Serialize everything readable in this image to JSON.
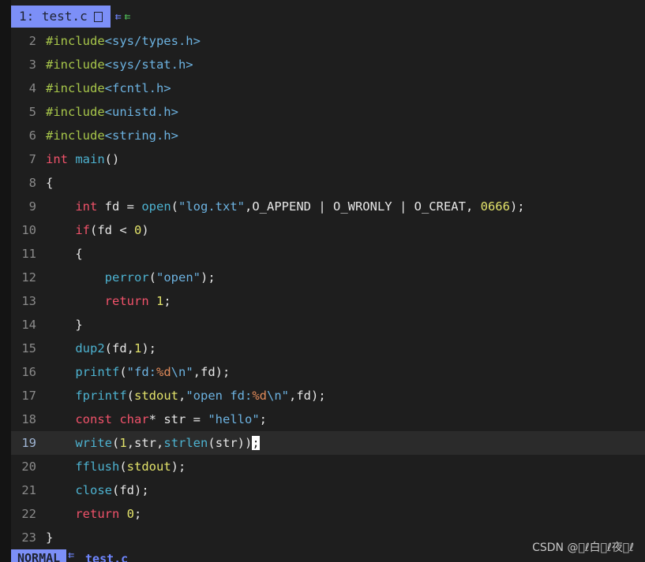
{
  "tabline": {
    "active_tab": "1: test.c",
    "arrow_left": "⇇",
    "arrow_right": "⇇"
  },
  "editor": {
    "current_line": "19",
    "lines": [
      {
        "n": "2",
        "tokens": [
          [
            "pp",
            "#include"
          ],
          [
            "inc",
            "<sys/types.h>"
          ]
        ]
      },
      {
        "n": "3",
        "tokens": [
          [
            "pp",
            "#include"
          ],
          [
            "inc",
            "<sys/stat.h>"
          ]
        ]
      },
      {
        "n": "4",
        "tokens": [
          [
            "pp",
            "#include"
          ],
          [
            "inc",
            "<fcntl.h>"
          ]
        ]
      },
      {
        "n": "5",
        "tokens": [
          [
            "pp",
            "#include"
          ],
          [
            "inc",
            "<unistd.h>"
          ]
        ]
      },
      {
        "n": "6",
        "tokens": [
          [
            "pp",
            "#include"
          ],
          [
            "inc",
            "<string.h>"
          ]
        ]
      },
      {
        "n": "7",
        "tokens": [
          [
            "kw",
            "int"
          ],
          [
            "txt",
            " "
          ],
          [
            "fn",
            "main"
          ],
          [
            "txt",
            "()"
          ]
        ]
      },
      {
        "n": "8",
        "tokens": [
          [
            "txt",
            "{"
          ]
        ]
      },
      {
        "n": "9",
        "tokens": [
          [
            "txt",
            "    "
          ],
          [
            "kw",
            "int"
          ],
          [
            "txt",
            " fd = "
          ],
          [
            "fn",
            "open"
          ],
          [
            "txt",
            "("
          ],
          [
            "str",
            "\"log.txt\""
          ],
          [
            "txt",
            ",O_APPEND | O_WRONLY | O_CREAT, "
          ],
          [
            "num",
            "0666"
          ],
          [
            "txt",
            ");"
          ]
        ]
      },
      {
        "n": "10",
        "tokens": [
          [
            "txt",
            "    "
          ],
          [
            "kw",
            "if"
          ],
          [
            "txt",
            "(fd < "
          ],
          [
            "num",
            "0"
          ],
          [
            "txt",
            ")"
          ]
        ]
      },
      {
        "n": "11",
        "tokens": [
          [
            "txt",
            "    {"
          ]
        ]
      },
      {
        "n": "12",
        "tokens": [
          [
            "txt",
            "        "
          ],
          [
            "fn",
            "perror"
          ],
          [
            "txt",
            "("
          ],
          [
            "str",
            "\"open\""
          ],
          [
            "txt",
            ");"
          ]
        ]
      },
      {
        "n": "13",
        "tokens": [
          [
            "txt",
            "        "
          ],
          [
            "kw",
            "return"
          ],
          [
            "txt",
            " "
          ],
          [
            "num",
            "1"
          ],
          [
            "txt",
            ";"
          ]
        ]
      },
      {
        "n": "14",
        "tokens": [
          [
            "txt",
            "    }"
          ]
        ]
      },
      {
        "n": "15",
        "tokens": [
          [
            "txt",
            "    "
          ],
          [
            "fn",
            "dup2"
          ],
          [
            "txt",
            "(fd,"
          ],
          [
            "num",
            "1"
          ],
          [
            "txt",
            ");"
          ]
        ]
      },
      {
        "n": "16",
        "tokens": [
          [
            "txt",
            "    "
          ],
          [
            "fn",
            "printf"
          ],
          [
            "txt",
            "("
          ],
          [
            "str",
            "\"fd:"
          ],
          [
            "fmt",
            "%d"
          ],
          [
            "str",
            "\\n\""
          ],
          [
            "txt",
            ",fd);"
          ]
        ]
      },
      {
        "n": "17",
        "tokens": [
          [
            "txt",
            "    "
          ],
          [
            "fn",
            "fprintf"
          ],
          [
            "txt",
            "("
          ],
          [
            "sym",
            "stdout"
          ],
          [
            "txt",
            ","
          ],
          [
            "str",
            "\"open fd:"
          ],
          [
            "fmt",
            "%d"
          ],
          [
            "str",
            "\\n\""
          ],
          [
            "txt",
            ",fd);"
          ]
        ]
      },
      {
        "n": "18",
        "tokens": [
          [
            "txt",
            "    "
          ],
          [
            "kw",
            "const"
          ],
          [
            "txt",
            " "
          ],
          [
            "kw",
            "char"
          ],
          [
            "txt",
            "* str = "
          ],
          [
            "str",
            "\"hello\""
          ],
          [
            "txt",
            ";"
          ]
        ]
      },
      {
        "n": "19",
        "tokens": [
          [
            "txt",
            "    "
          ],
          [
            "fn",
            "write"
          ],
          [
            "txt",
            "("
          ],
          [
            "num",
            "1"
          ],
          [
            "txt",
            ",str,"
          ],
          [
            "fn",
            "strlen"
          ],
          [
            "txt",
            "(str))"
          ],
          [
            "cur",
            ";"
          ]
        ]
      },
      {
        "n": "20",
        "tokens": [
          [
            "txt",
            "    "
          ],
          [
            "fn",
            "fflush"
          ],
          [
            "txt",
            "("
          ],
          [
            "sym",
            "stdout"
          ],
          [
            "txt",
            ");"
          ]
        ]
      },
      {
        "n": "21",
        "tokens": [
          [
            "txt",
            "    "
          ],
          [
            "fn",
            "close"
          ],
          [
            "txt",
            "(fd);"
          ]
        ]
      },
      {
        "n": "22",
        "tokens": [
          [
            "txt",
            "    "
          ],
          [
            "kw",
            "return"
          ],
          [
            "txt",
            " "
          ],
          [
            "num",
            "0"
          ],
          [
            "txt",
            ";"
          ]
        ]
      },
      {
        "n": "23",
        "tokens": [
          [
            "txt",
            "}"
          ]
        ]
      }
    ]
  },
  "statusline": {
    "mode": "NORMAL",
    "arrow": "⇇",
    "filename": "test.c"
  },
  "watermark": "CSDN @\u0000ℓ白\u0000ℓ夜\u0000ℓ",
  "colors": {
    "background": "#1e1e1e",
    "accent": "#7c8ff7",
    "keyword": "#f0526a",
    "function": "#4db2d0",
    "string": "#6cb2e0",
    "number": "#e2e26a",
    "preprocessor": "#a7c64a"
  }
}
